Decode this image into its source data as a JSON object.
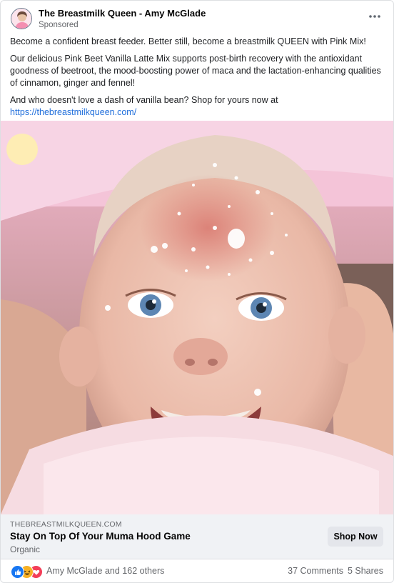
{
  "post": {
    "page_name": "The Breastmilk Queen - Amy McGlade",
    "sponsored_label": "Sponsored",
    "paragraphs": [
      "Become a confident breast feeder. Better still, become a breastmilk QUEEN with Pink Mix!",
      "Our delicious Pink Beet Vanilla Latte Mix supports post-birth recovery with the antioxidant goodness of beetroot, the mood-boosting power of maca and the lactation-enhancing qualities of cinnamon, ginger and fennel!",
      "And who doesn't love a dash of vanilla bean? Shop for yours now at"
    ],
    "link_text": "https://thebreastmilkqueen.com/",
    "more_icon": "more-horizontal-icon",
    "image_icon": "ad-photo"
  },
  "cta": {
    "domain": "THEBREASTMILKQUEEN.COM",
    "headline": "Stay On Top Of Your Muma Hood Game",
    "description": "Organic",
    "button_label": "Shop Now"
  },
  "footer": {
    "reaction_icons": [
      "like-icon",
      "haha-icon",
      "love-icon"
    ],
    "reaction_names": "Amy McGlade and 162 others",
    "comments": "37 Comments",
    "shares": "5 Shares"
  },
  "colors": {
    "link": "#216fdb",
    "like": "#1877f2",
    "haha": "#f7b125",
    "love": "#f33e58",
    "cta_background": "#f0f2f5"
  }
}
